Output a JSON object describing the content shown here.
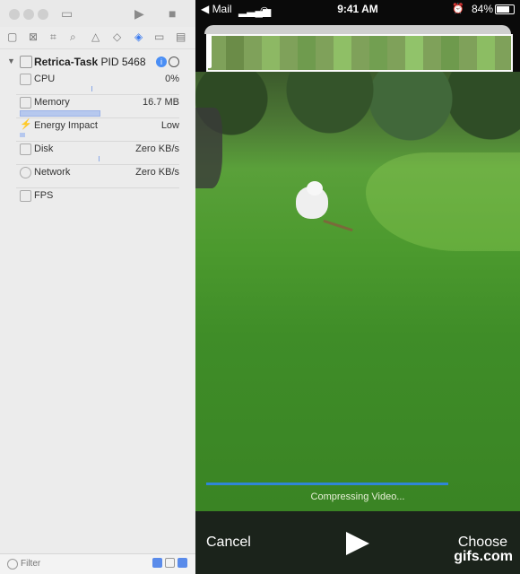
{
  "xcode": {
    "process": {
      "name": "Retrica-Task",
      "pid_label": "PID 5468"
    },
    "gauges": [
      {
        "label": "CPU",
        "value": "0%"
      },
      {
        "label": "Memory",
        "value": "16.7 MB"
      },
      {
        "label": "Energy Impact",
        "value": "Low"
      },
      {
        "label": "Disk",
        "value": "Zero KB/s"
      },
      {
        "label": "Network",
        "value": "Zero KB/s"
      },
      {
        "label": "FPS",
        "value": ""
      }
    ],
    "filter_placeholder": "Filter"
  },
  "phone": {
    "status": {
      "back_app": "◀ Mail",
      "time": "9:41 AM",
      "battery": "84%"
    },
    "compressing_text": "Compressing Video...",
    "compress_progress": 0.8,
    "cancel_label": "Cancel",
    "choose_label": "Choose"
  },
  "watermark": "gifs.com",
  "colors": {
    "accent": "#2f86d8",
    "grass": "#4c9a2e"
  }
}
